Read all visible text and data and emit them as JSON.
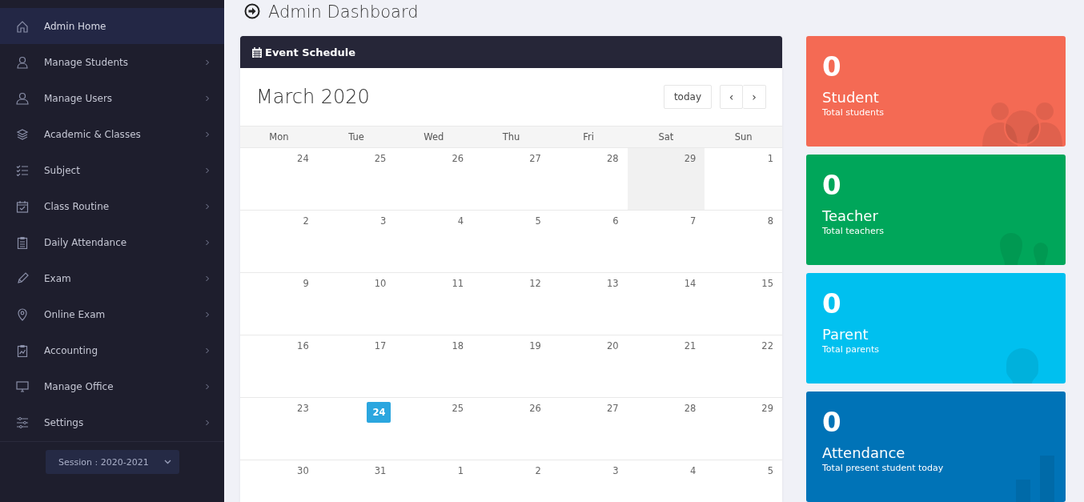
{
  "sidebar": {
    "items": [
      {
        "label": "Admin Home",
        "selected": true,
        "expandable": false
      },
      {
        "label": "Manage Students",
        "selected": false,
        "expandable": true
      },
      {
        "label": "Manage Users",
        "selected": false,
        "expandable": true
      },
      {
        "label": "Academic & Classes",
        "selected": false,
        "expandable": true
      },
      {
        "label": "Subject",
        "selected": false,
        "expandable": true
      },
      {
        "label": "Class Routine",
        "selected": false,
        "expandable": true
      },
      {
        "label": "Daily Attendance",
        "selected": false,
        "expandable": true
      },
      {
        "label": "Exam",
        "selected": false,
        "expandable": true
      },
      {
        "label": "Online Exam",
        "selected": false,
        "expandable": true
      },
      {
        "label": "Accounting",
        "selected": false,
        "expandable": true
      },
      {
        "label": "Manage Office",
        "selected": false,
        "expandable": true
      },
      {
        "label": "Settings",
        "selected": false,
        "expandable": true
      }
    ],
    "session": "Session : 2020-2021"
  },
  "page_title": "Admin Dashboard",
  "calendar": {
    "panel_title": "Event Schedule",
    "month": "March 2020",
    "today_button": "today",
    "prev_button": "‹",
    "next_button": "›",
    "weekdays": [
      "Mon",
      "Tue",
      "Wed",
      "Thu",
      "Fri",
      "Sat",
      "Sun"
    ],
    "weeks": [
      [
        {
          "day": "24",
          "today": false,
          "shaded": false
        },
        {
          "day": "25",
          "today": false,
          "shaded": false
        },
        {
          "day": "26",
          "today": false,
          "shaded": false
        },
        {
          "day": "27",
          "today": false,
          "shaded": false
        },
        {
          "day": "28",
          "today": false,
          "shaded": false
        },
        {
          "day": "29",
          "today": false,
          "shaded": true
        },
        {
          "day": "1",
          "today": false,
          "shaded": false
        }
      ],
      [
        {
          "day": "2",
          "today": false,
          "shaded": false
        },
        {
          "day": "3",
          "today": false,
          "shaded": false
        },
        {
          "day": "4",
          "today": false,
          "shaded": false
        },
        {
          "day": "5",
          "today": false,
          "shaded": false
        },
        {
          "day": "6",
          "today": false,
          "shaded": false
        },
        {
          "day": "7",
          "today": false,
          "shaded": false
        },
        {
          "day": "8",
          "today": false,
          "shaded": false
        }
      ],
      [
        {
          "day": "9",
          "today": false,
          "shaded": false
        },
        {
          "day": "10",
          "today": false,
          "shaded": false
        },
        {
          "day": "11",
          "today": false,
          "shaded": false
        },
        {
          "day": "12",
          "today": false,
          "shaded": false
        },
        {
          "day": "13",
          "today": false,
          "shaded": false
        },
        {
          "day": "14",
          "today": false,
          "shaded": false
        },
        {
          "day": "15",
          "today": false,
          "shaded": false
        }
      ],
      [
        {
          "day": "16",
          "today": false,
          "shaded": false
        },
        {
          "day": "17",
          "today": false,
          "shaded": false
        },
        {
          "day": "18",
          "today": false,
          "shaded": false
        },
        {
          "day": "19",
          "today": false,
          "shaded": false
        },
        {
          "day": "20",
          "today": false,
          "shaded": false
        },
        {
          "day": "21",
          "today": false,
          "shaded": false
        },
        {
          "day": "22",
          "today": false,
          "shaded": false
        }
      ],
      [
        {
          "day": "23",
          "today": false,
          "shaded": false
        },
        {
          "day": "24",
          "today": true,
          "shaded": false
        },
        {
          "day": "25",
          "today": false,
          "shaded": false
        },
        {
          "day": "26",
          "today": false,
          "shaded": false
        },
        {
          "day": "27",
          "today": false,
          "shaded": false
        },
        {
          "day": "28",
          "today": false,
          "shaded": false
        },
        {
          "day": "29",
          "today": false,
          "shaded": false
        }
      ],
      [
        {
          "day": "30",
          "today": false,
          "shaded": false
        },
        {
          "day": "31",
          "today": false,
          "shaded": false
        },
        {
          "day": "1",
          "today": false,
          "shaded": false
        },
        {
          "day": "2",
          "today": false,
          "shaded": false
        },
        {
          "day": "3",
          "today": false,
          "shaded": false
        },
        {
          "day": "4",
          "today": false,
          "shaded": false
        },
        {
          "day": "5",
          "today": false,
          "shaded": false
        }
      ]
    ]
  },
  "stat_cards": [
    {
      "kind": "students",
      "value": "0",
      "title": "Student",
      "subtitle": "Total students",
      "color": "#f46a54"
    },
    {
      "kind": "teachers",
      "value": "0",
      "title": "Teacher",
      "subtitle": "Total teachers",
      "color": "#00a65a"
    },
    {
      "kind": "parents",
      "value": "0",
      "title": "Parent",
      "subtitle": "Total parents",
      "color": "#00c0ef"
    },
    {
      "kind": "attendance",
      "value": "0",
      "title": "Attendance",
      "subtitle": "Total present student today",
      "color": "#0073b7"
    }
  ]
}
